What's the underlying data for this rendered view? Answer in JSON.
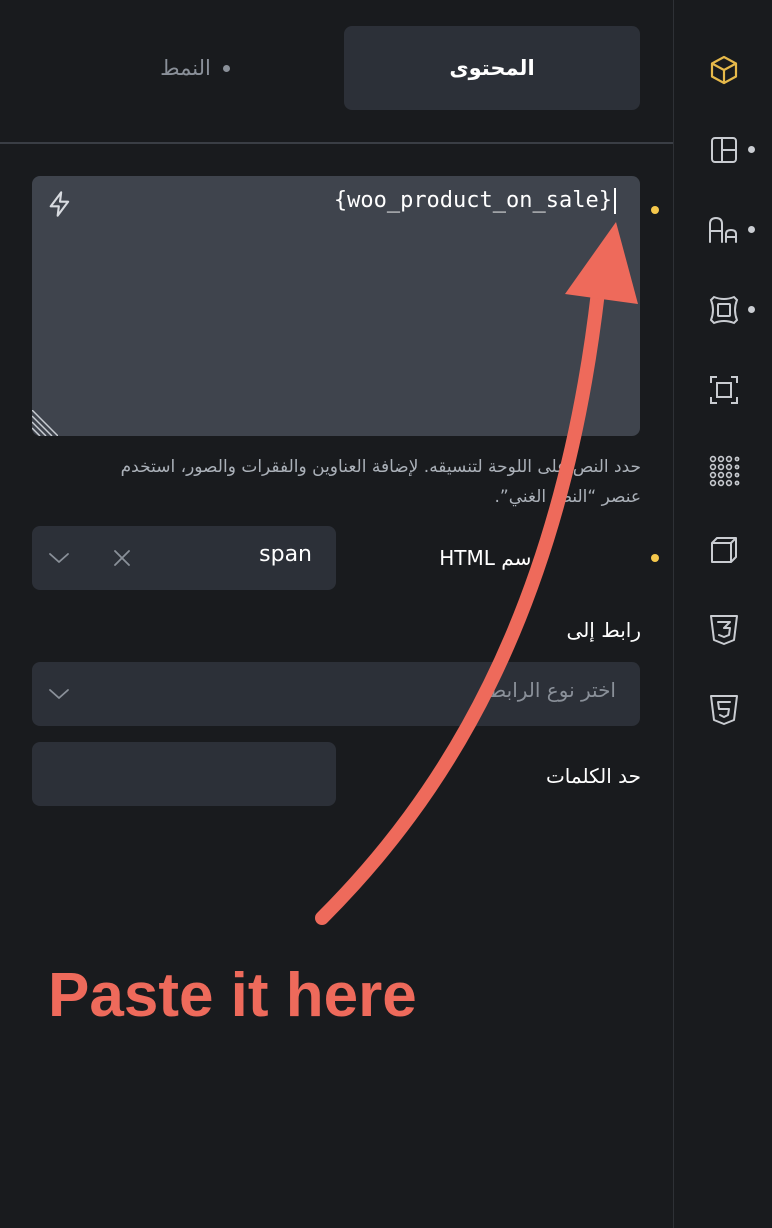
{
  "tabs": {
    "content": "المحتوى",
    "style": "النمط"
  },
  "text_field": {
    "value": "{woo_product_on_sale}"
  },
  "hint": "حدد النص على اللوحة لتنسيقه. لإضافة العناوين والفقرات والصور، استخدم عنصر “النص الغني”.",
  "html_tag": {
    "label": "وسم HTML",
    "value": "span"
  },
  "link": {
    "label": "رابط إلى",
    "placeholder": "اختر نوع الرابط"
  },
  "word_limit": {
    "label": "حد الكلمات"
  },
  "annotation": {
    "text": "Paste it here",
    "color": "#ee6a5b"
  },
  "colors": {
    "accent": "#f5c84c",
    "panel": "#191b1e",
    "input": "#2c3038"
  },
  "rail_icons": [
    "cube-icon",
    "layout-icon",
    "typography-icon",
    "border-icon",
    "frame-icon",
    "dots-grid-icon",
    "box-3d-icon",
    "css3-icon",
    "html5-icon"
  ]
}
